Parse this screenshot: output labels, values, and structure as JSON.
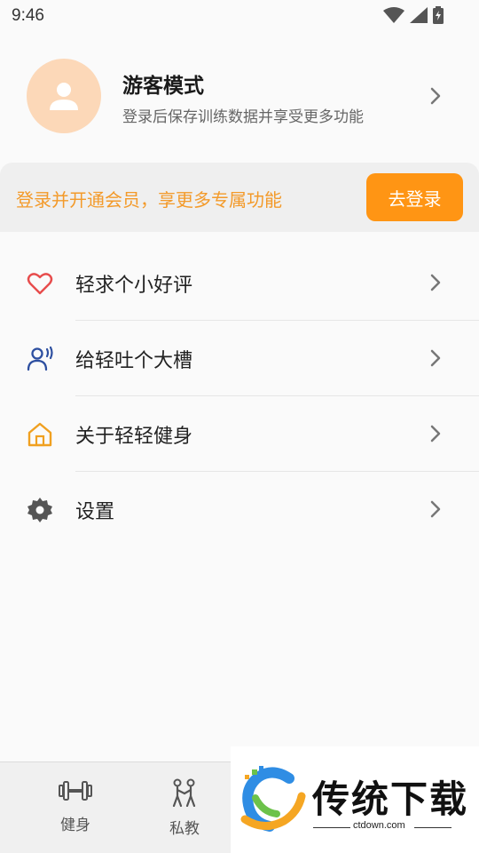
{
  "status_bar": {
    "time": "9:46"
  },
  "profile": {
    "name": "游客模式",
    "subtitle": "登录后保存训练数据并享受更多功能"
  },
  "banner": {
    "text": "登录并开通会员，享更多专属功能",
    "login_label": "去登录"
  },
  "menu": {
    "items": [
      {
        "label": "轻求个小好评",
        "icon": "heart-icon"
      },
      {
        "label": "给轻吐个大槽",
        "icon": "feedback-person-icon"
      },
      {
        "label": "关于轻轻健身",
        "icon": "home-icon"
      },
      {
        "label": "设置",
        "icon": "gear-icon"
      }
    ]
  },
  "bottom_nav": {
    "items": [
      {
        "label": "健身",
        "icon": "dumbbell-icon"
      },
      {
        "label": "私教",
        "icon": "personal-trainer-icon"
      }
    ]
  },
  "watermark": {
    "title": "传统下载",
    "url": "ctdown.com"
  },
  "colors": {
    "accent": "#ff9514",
    "banner_text": "#f39a2a",
    "avatar_bg": "#fcd8b8"
  }
}
